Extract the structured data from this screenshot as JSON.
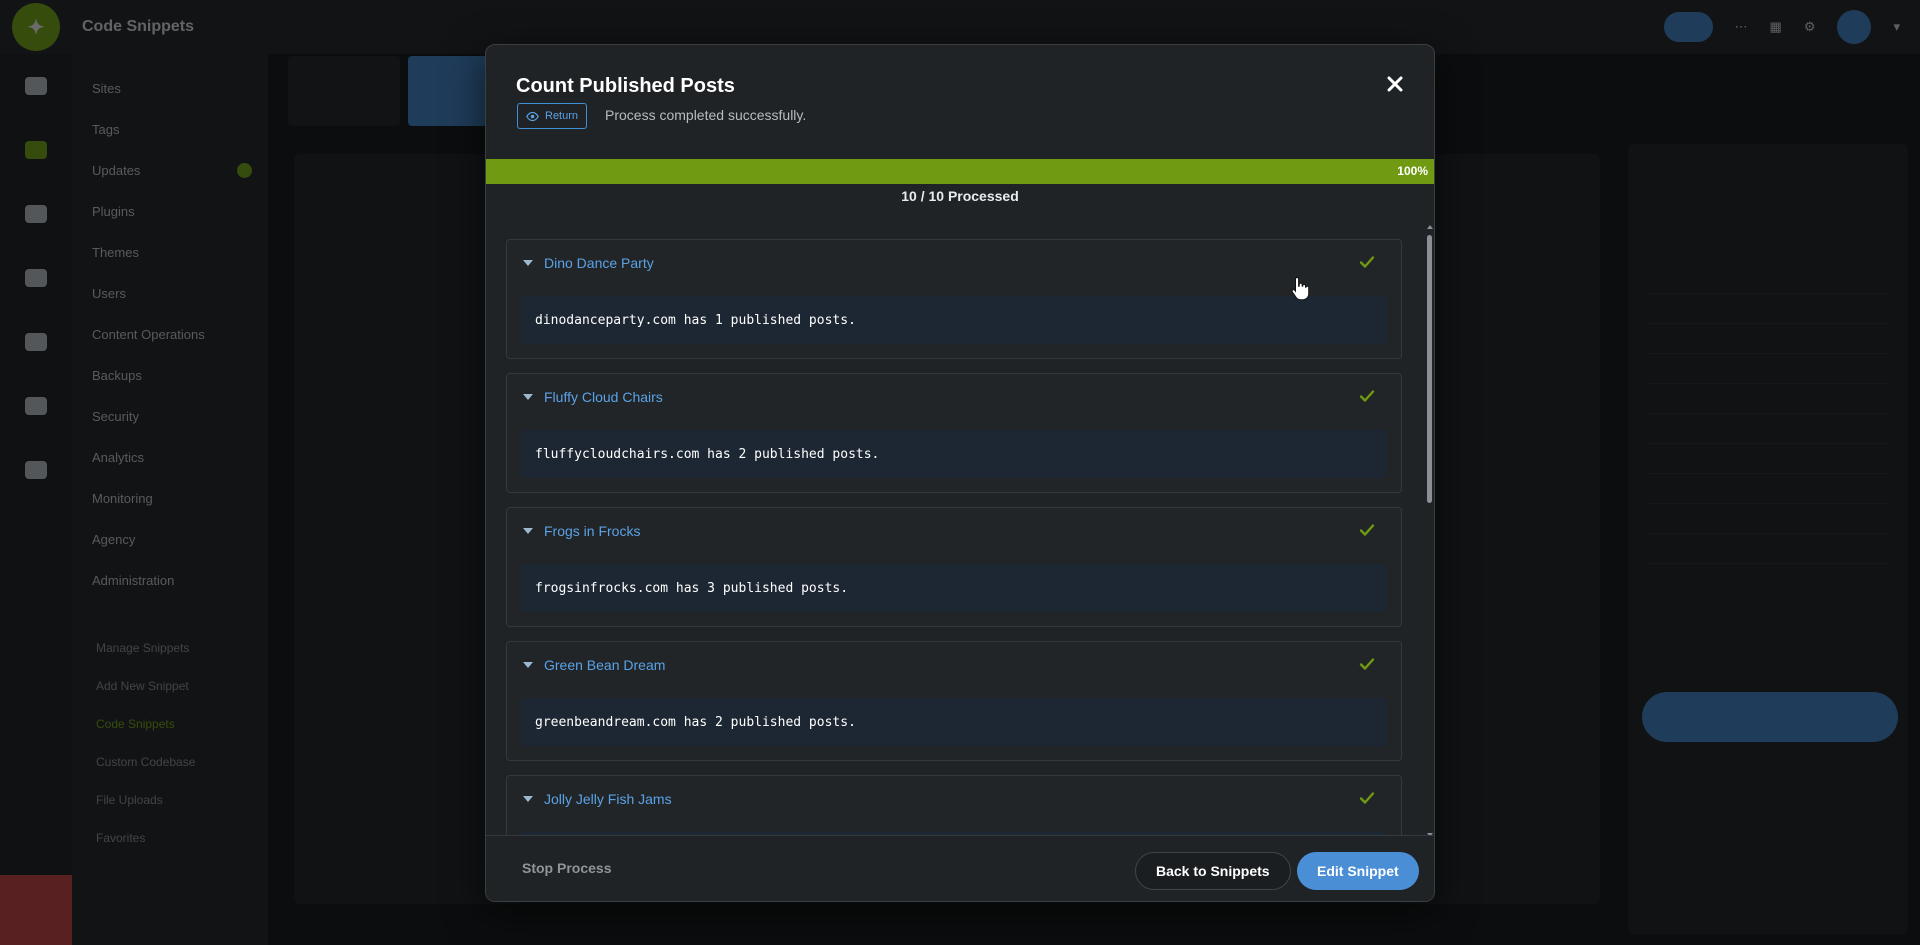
{
  "app": {
    "title": "Code Snippets",
    "sidebar_items": [
      "Sites",
      "Tags",
      "Updates",
      "Plugins",
      "Themes",
      "Users",
      "Content Operations",
      "Backups",
      "Security",
      "Analytics",
      "Monitoring",
      "Agency",
      "Administration"
    ],
    "subnav_items": [
      "Manage Snippets",
      "Add New Snippet",
      "Code Snippets",
      "Custom Codebase",
      "File Uploads",
      "Favorites"
    ]
  },
  "modal": {
    "title": "Count Published Posts",
    "return_label": "Return",
    "status": "Process completed successfully.",
    "progress": {
      "percent_label": "100%",
      "fraction": 1.0,
      "count_label": "10 / 10 Processed"
    },
    "results": [
      {
        "site": "Dino Dance Party",
        "output": "dinodanceparty.com has 1 published posts."
      },
      {
        "site": "Fluffy Cloud Chairs",
        "output": "fluffycloudchairs.com has 2 published posts."
      },
      {
        "site": "Frogs in Frocks",
        "output": "frogsinfrocks.com has 3 published posts."
      },
      {
        "site": "Green Bean Dream",
        "output": "greenbeandream.com has 2 published posts."
      },
      {
        "site": "Jolly Jelly Fish Jams",
        "output": ""
      }
    ],
    "footer": {
      "stop_label": "Stop Process",
      "back_label": "Back to Snippets",
      "edit_label": "Edit Snippet"
    }
  },
  "colors": {
    "accent_blue": "#4a8fd6",
    "success_green": "#6f9a12",
    "link_blue": "#5aa2e6"
  },
  "icons": {
    "close": "close-icon",
    "return": "eye-icon",
    "status": "check-icon",
    "expand": "caret-down-icon"
  }
}
